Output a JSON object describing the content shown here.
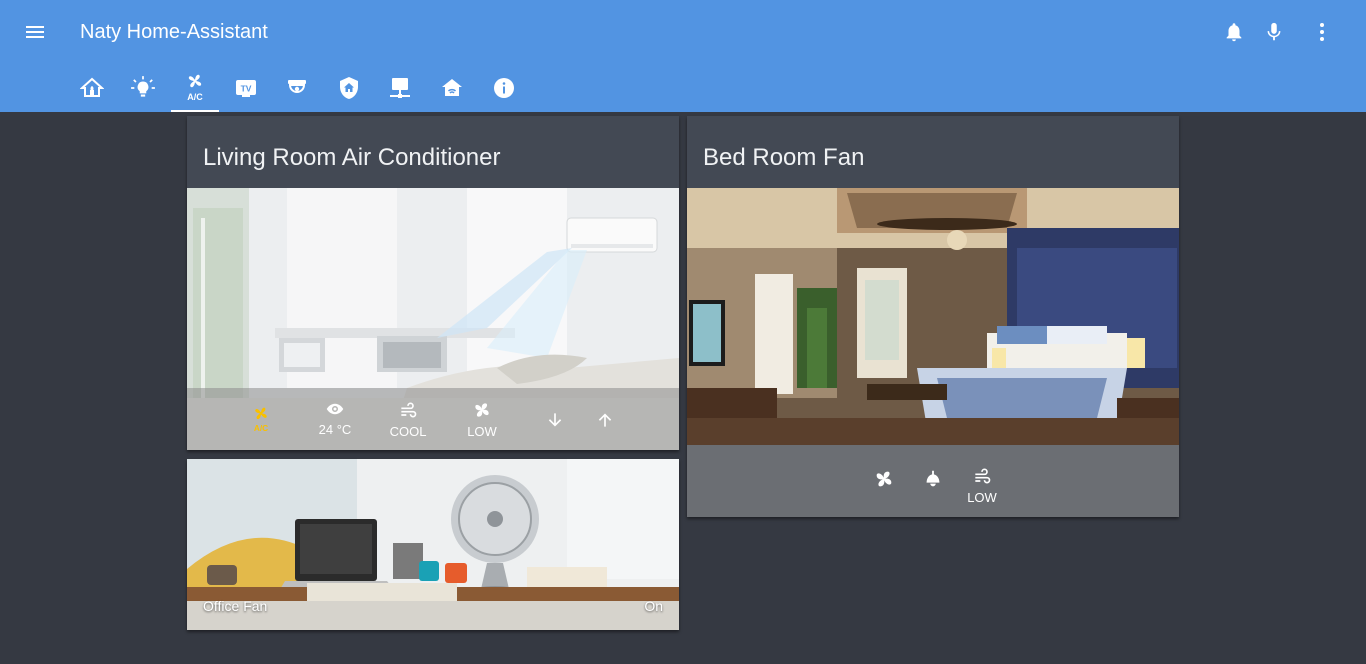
{
  "app": {
    "title": "Naty Home-Assistant",
    "accent_color": "#5294e2",
    "background_color": "#353942"
  },
  "header": {
    "menu_icon": "menu-icon",
    "actions": [
      {
        "name": "notifications",
        "icon": "bell-icon"
      },
      {
        "name": "voice",
        "icon": "microphone-icon"
      },
      {
        "name": "more",
        "icon": "dots-vertical-icon"
      }
    ]
  },
  "tabs": [
    {
      "name": "home",
      "icon": "home-leaf-icon",
      "active": false
    },
    {
      "name": "lights",
      "icon": "lightbulb-icon",
      "active": false
    },
    {
      "name": "ac",
      "icon": "ac-fan-icon",
      "label": "A/C",
      "active": true
    },
    {
      "name": "tv",
      "icon": "tv-icon",
      "label": "TV",
      "active": false
    },
    {
      "name": "camera",
      "icon": "cctv-icon",
      "active": false
    },
    {
      "name": "security",
      "icon": "shield-home-icon",
      "active": false
    },
    {
      "name": "network",
      "icon": "desktop-network-icon",
      "active": false
    },
    {
      "name": "house",
      "icon": "house-signal-icon",
      "active": false
    },
    {
      "name": "info",
      "icon": "info-icon",
      "active": false
    }
  ],
  "cards": {
    "living_ac": {
      "title": "Living Room Air Conditioner",
      "controls": {
        "mode_icon": "ac-fan-icon",
        "mode_label": "A/C",
        "mode_color": "#f9c000",
        "temperature": "24 °C",
        "hvac_mode": "COOL",
        "fan_speed": "LOW",
        "temp_down_icon": "arrow-down-icon",
        "temp_up_icon": "arrow-up-icon"
      }
    },
    "bed_fan": {
      "title": "Bed Room Fan",
      "controls": {
        "fan_icon": "fan-icon",
        "oscillate_icon": "ceiling-light-icon",
        "speed_icon": "weather-windy-icon",
        "speed": "LOW"
      }
    },
    "office_fan": {
      "name": "Office Fan",
      "state": "On"
    }
  }
}
